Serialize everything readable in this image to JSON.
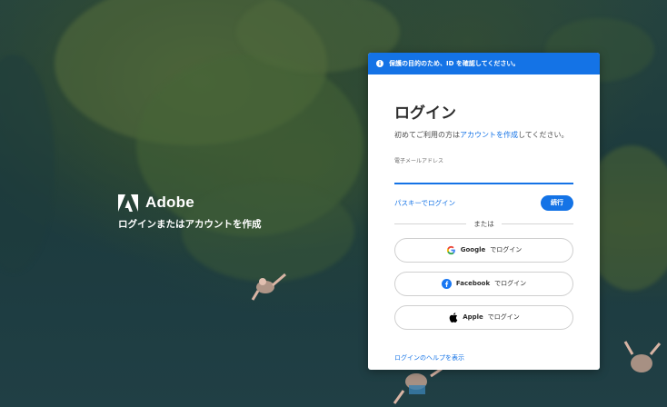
{
  "brand": {
    "name": "Adobe",
    "tagline": "ログインまたはアカウントを作成"
  },
  "login_card": {
    "banner_text": "保護の目的のため、ID を確認してください。",
    "title": "ログイン",
    "subtitle_prefix": "初めてご利用の方は",
    "subtitle_link": "アカウントを作成",
    "subtitle_suffix": "してください。",
    "email_label": "電子メールアドレス",
    "email_value": "",
    "passkey_link": "パスキーでログイン",
    "continue_button": "続行",
    "divider_text": "または",
    "social_suffix": "でログイン",
    "social": [
      {
        "provider": "Google",
        "icon": "google-icon"
      },
      {
        "provider": "Facebook",
        "icon": "facebook-icon"
      },
      {
        "provider": "Apple",
        "icon": "apple-icon"
      }
    ],
    "help_link": "ログインのヘルプを表示"
  },
  "colors": {
    "accent": "#1473e6",
    "facebook": "#1877f2",
    "background": "#1f3a3a"
  }
}
